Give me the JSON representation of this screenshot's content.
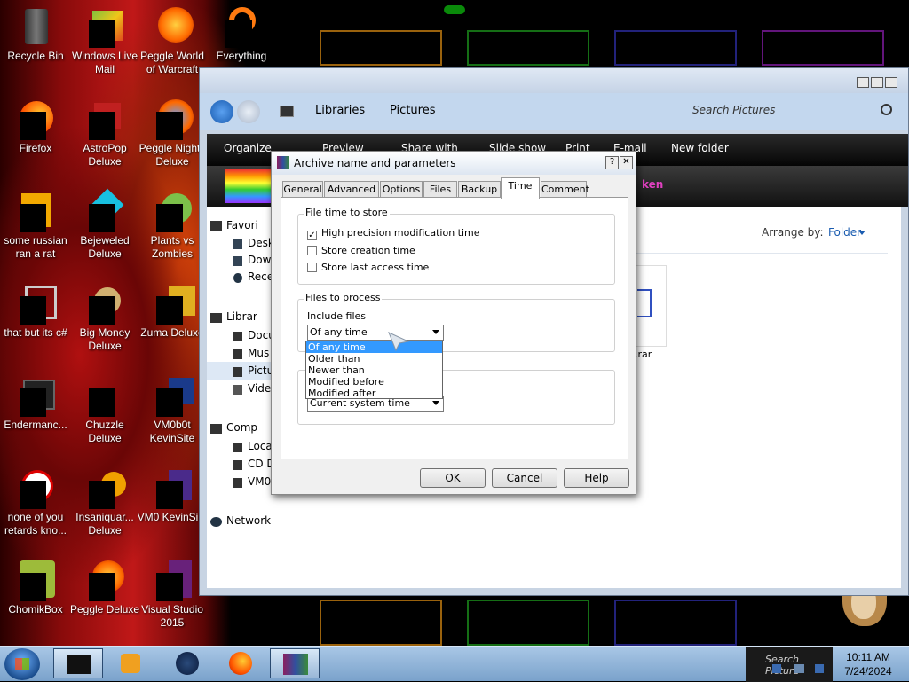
{
  "desktop": {
    "icons": [
      {
        "label": "Recycle Bin"
      },
      {
        "label": "Windows Live Mail"
      },
      {
        "label": "Peggle World of Warcraft"
      },
      {
        "label": "Everything"
      },
      {
        "label": "Firefox"
      },
      {
        "label": "AstroPop Deluxe"
      },
      {
        "label": "Peggle Nights Deluxe"
      },
      {
        "label": "some russian ran a rat"
      },
      {
        "label": "Bejeweled Deluxe"
      },
      {
        "label": "Plants vs Zombies"
      },
      {
        "label": "that but its c#"
      },
      {
        "label": "Big Money Deluxe"
      },
      {
        "label": "Zuma Deluxe"
      },
      {
        "label": "Endermanc..."
      },
      {
        "label": "Chuzzle Deluxe"
      },
      {
        "label": "VM0b0t KevinSite"
      },
      {
        "label": "none of you retards kno..."
      },
      {
        "label": "Insaniquar... Deluxe"
      },
      {
        "label": "VM0 KevinSi..."
      },
      {
        "label": "ChomikBox"
      },
      {
        "label": "Peggle Deluxe"
      },
      {
        "label": "Visual Studio 2015"
      }
    ]
  },
  "explorer": {
    "breadcrumb": [
      "Libraries",
      "Pictures"
    ],
    "search_placeholder": "Search Pictures",
    "toolbar": [
      "Organize",
      "Preview",
      "Share with",
      "Slide show",
      "Print",
      "E-mail",
      "New folder"
    ],
    "banner_text": "ken",
    "arrange_by_label": "Arrange by:",
    "arrange_by_value": "Folder",
    "nav_items": [
      "Favori",
      "Desk",
      "Dow",
      "Rece",
      "Librar",
      "Docu",
      "Mus",
      "Pictu",
      "Vide",
      "Comp",
      "Loca",
      "CD D",
      "VM0",
      "Network"
    ],
    "file_caption": ".rar"
  },
  "dialog": {
    "title": "Archive name and parameters",
    "help_glyph": "?",
    "close_glyph": "✕",
    "tabs": [
      "General",
      "Advanced",
      "Options",
      "Files",
      "Backup",
      "Time",
      "Comment"
    ],
    "active_tab": "Time",
    "file_time_group": "File time to store",
    "checkboxes": [
      {
        "label": "High precision modification time",
        "checked": true
      },
      {
        "label": "Store creation time",
        "checked": false
      },
      {
        "label": "Store last access time",
        "checked": false
      }
    ],
    "files_group": "Files to process",
    "include_label": "Include files",
    "include_value": "Of any time",
    "include_options": [
      "Of any time",
      "Older than",
      "Newer than",
      "Modified before",
      "Modified after"
    ],
    "second_combo_value": "Current system time",
    "buttons": {
      "ok": "OK",
      "cancel": "Cancel",
      "help": "Help"
    }
  },
  "taskbar": {
    "time": "10:11 AM",
    "date": "7/24/2024",
    "tray_search": "Search Picture"
  }
}
